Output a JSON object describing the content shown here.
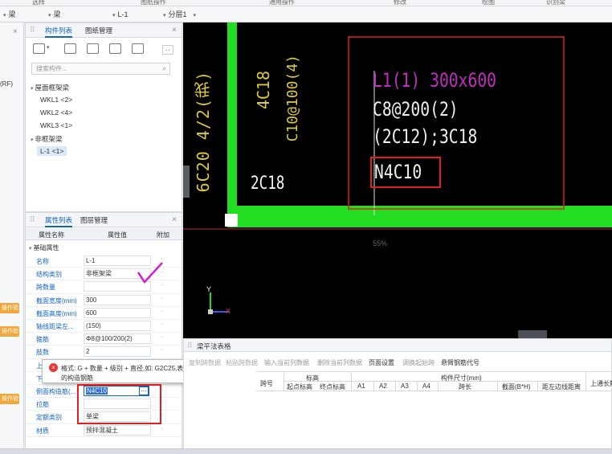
{
  "topbar": {
    "labels": [
      "选择",
      "图纸操作",
      "通用操作",
      "修改",
      "绘图",
      "识别梁"
    ],
    "selectors": [
      "梁",
      "梁",
      "L-1",
      "分层1"
    ]
  },
  "left_strip": {
    "items": [
      "(RF)"
    ],
    "badges": [
      "操作验",
      "操作验",
      "操作验"
    ]
  },
  "component_panel": {
    "tabs": [
      "构件列表",
      "图纸管理"
    ],
    "search_placeholder": "搜索构件...",
    "tree": [
      {
        "label": "屋面框架梁",
        "children": [
          "WKL1 <2>",
          "WKL2 <4>",
          "WKL3 <1>"
        ]
      },
      {
        "label": "非框架梁",
        "children": [
          "L-1 <1>"
        ]
      }
    ]
  },
  "property_panel": {
    "tabs": [
      "属性列表",
      "图层管理"
    ],
    "headers": [
      "属性名称",
      "属性值",
      "附加"
    ],
    "group": "基础属性",
    "rows": [
      {
        "name": "名称",
        "value": "L-1"
      },
      {
        "name": "结构类别",
        "value": "非框架梁"
      },
      {
        "name": "跨数量",
        "value": ""
      },
      {
        "name": "截面宽度(mm)",
        "value": "300"
      },
      {
        "name": "截面高度(mm)",
        "value": "600"
      },
      {
        "name": "轴线距梁左...",
        "value": "(150)"
      },
      {
        "name": "箍筋",
        "value": "Φ8@100/200(2)"
      },
      {
        "name": "肢数",
        "value": "2"
      },
      {
        "name": "上部通长筋",
        "value": ""
      },
      {
        "name": "下部通长筋",
        "value": ""
      },
      {
        "name": "侧面构造筋(...",
        "value": "N4C10"
      },
      {
        "name": "拉筋",
        "value": ""
      },
      {
        "name": "定额类别",
        "value": "单梁"
      },
      {
        "name": "材质",
        "value": "预拌混凝土"
      }
    ]
  },
  "tooltip": {
    "text_line1": "格式: G + 数量 + 级别 + 直径,如: G2C25,表示从前到尾两",
    "text_line2": "的构造钢筋"
  },
  "canvas": {
    "texts_vertical": [
      "6C20 4/2(我)",
      "4C18",
      "C10@100(4)"
    ],
    "label_2c18": "2C18",
    "annotation": {
      "line1": "L1(1) 300x600",
      "line2": "C8@200(2)",
      "line3": "(2C12);3C18",
      "line4": "N4C10"
    },
    "zoom": "55%",
    "axis_y": "Y",
    "axis_x": "X"
  },
  "beam_table": {
    "title": "梁平法表格",
    "toolbar": [
      "复制跨数据",
      "粘贴跨数据",
      "输入当前列数据",
      "删除当前列数据",
      "页面设置",
      "调换起始跨",
      "悬臂钢筋代号"
    ],
    "headers_top": [
      "跨号",
      "标高",
      "构件尺寸(mm)",
      "上通长筋"
    ],
    "headers_sub": [
      "起点标高",
      "终点标高",
      "A1",
      "A2",
      "A3",
      "A4",
      "跨长",
      "截面(B*H)",
      "距左边线距离"
    ]
  },
  "colors": {
    "accent": "#1565c0",
    "canvas_bg": "#000000",
    "green_beam": "#22dd22",
    "red_box": "#e02020",
    "magenta": "#cc22cc",
    "check_mark": "#cc22cc"
  }
}
